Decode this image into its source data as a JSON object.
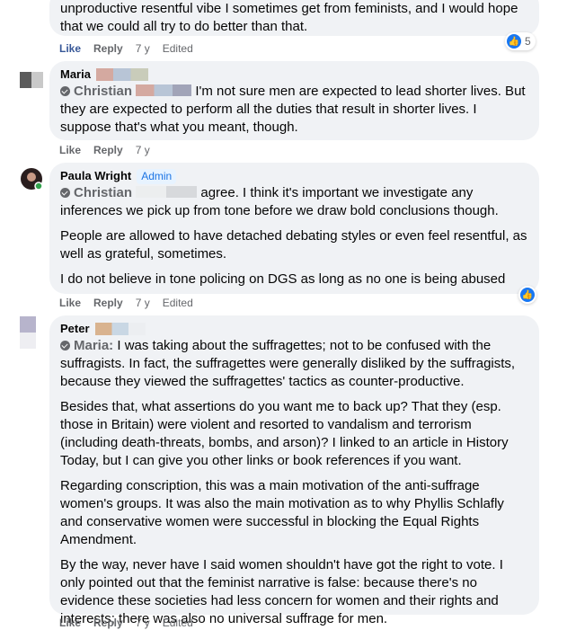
{
  "comments": [
    {
      "paragraphs": [
        "unproductive resentful vibe I sometimes get from feminists, and I would hope that we could all try to do better than that."
      ],
      "actions": {
        "like": "Like",
        "reply": "Reply",
        "time": "7 y",
        "edited": "Edited"
      },
      "reaction_count": "5"
    },
    {
      "author": "Maria",
      "mention": "Christian",
      "text": "I'm not sure men are expected to lead shorter lives. But they are expected to perform all the duties that result in shorter lives. I suppose that's what you meant, though.",
      "actions": {
        "like": "Like",
        "reply": "Reply",
        "time": "7 y"
      }
    },
    {
      "author": "Paula Wright",
      "badge": "Admin",
      "mention": "Christian",
      "text": "agree. I think it's important we investigate any inferences we pick up from tone before we draw bold conclusions though.",
      "paragraphs": [
        "People are allowed to have detached debating styles or even feel resentful, as well as grateful, sometimes.",
        "I do not believe in tone policing on DGS as long as no one is being abused"
      ],
      "actions": {
        "like": "Like",
        "reply": "Reply",
        "time": "7 y",
        "edited": "Edited"
      }
    },
    {
      "author": "Peter",
      "mention": "Maria:",
      "text": "I was taking about the suffragettes; not to be confused with the suffragists. In fact, the suffragettes were generally disliked by the suffragists, because they viewed the suffragettes' tactics as counter-productive.",
      "paragraphs": [
        "Besides that, what assertions do you want me to back up? That they (esp. those in Britain) were violent and resorted to vandalism and terrorism (including death-threats, bombs, and arson)? I linked to an article in History Today, but I can give you other links or book references if you want.",
        "Regarding conscription, this was a main motivation of the anti-suffrage women's groups. It was also the main motivation as to why Phyllis Schlafly and conservative women were successful in blocking the Equal Rights Amendment.",
        "By the way, never have I said women shouldn't have got the right to vote. I only pointed out that the feminist narrative is false: because there's no evidence these societies had less concern for women and their rights and interests; there was also no universal suffrage for men."
      ],
      "actions": {
        "like": "Like",
        "reply": "Reply",
        "time": "7 y",
        "edited": "Edited"
      }
    }
  ],
  "colors": {
    "bubble": "#f0f2f5",
    "secondary": "#65676b",
    "accent": "#1877f2"
  }
}
